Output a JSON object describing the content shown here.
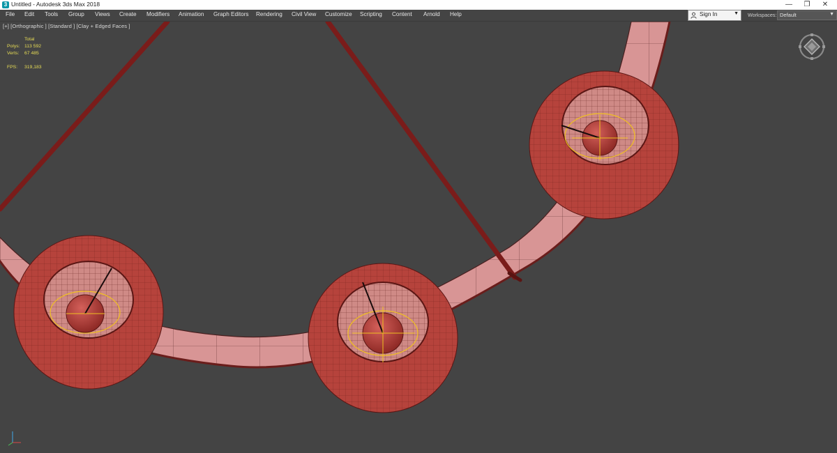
{
  "window": {
    "title": "Untitled - Autodesk 3ds Max 2018",
    "controls": {
      "minimize": "—",
      "maximize": "❐",
      "close": "✕"
    }
  },
  "menu": {
    "items": [
      "File",
      "Edit",
      "Tools",
      "Group",
      "Views",
      "Create",
      "Modifiers",
      "Animation",
      "Graph Editors",
      "Rendering",
      "Civil View",
      "Customize",
      "Scripting",
      "Content",
      "Arnold",
      "Help"
    ]
  },
  "account": {
    "signin_label": "Sign In",
    "icon": "user-icon"
  },
  "workspaces": {
    "label": "Workspaces:",
    "value": "Default"
  },
  "viewport": {
    "label": "[+] [Orthographic ] [Standard ] [Clay + Edged Faces ]",
    "stats": {
      "header": "Total",
      "polys_label": "Polys:",
      "polys_value": "113 592",
      "verts_label": "Verts:",
      "verts_value": "67 485",
      "fps_label": "FPS:",
      "fps_value": "319,183"
    }
  },
  "colors": {
    "viewport_bg": "#444444",
    "ring_fill": "#d89595",
    "shade_fill": "#b6433c",
    "rod_color": "#7a1c1a",
    "stats_text": "#e8dd55",
    "bulb_outline": "#f0c020"
  }
}
